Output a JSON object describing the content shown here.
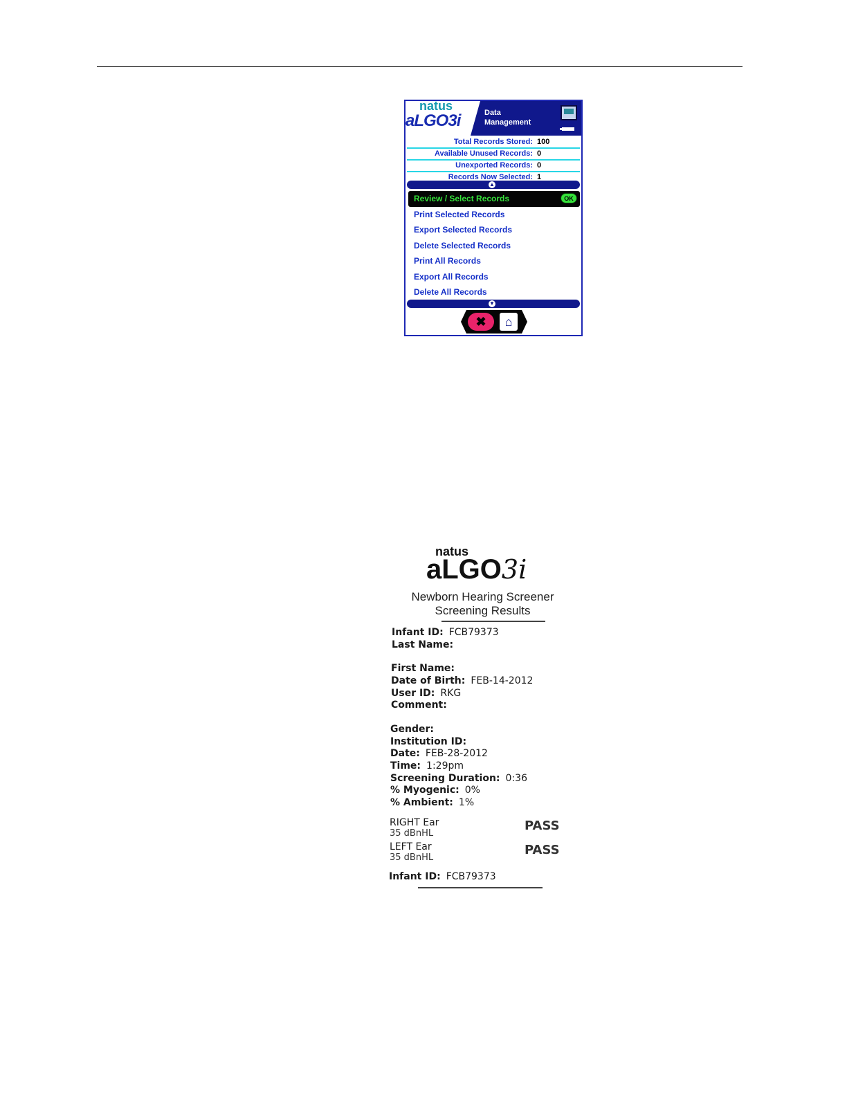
{
  "device_screen": {
    "logo_top": "natus",
    "logo_main": "aLGO",
    "logo_suffix": "3i",
    "title_line1": "Data",
    "title_line2": "Management",
    "stats": [
      {
        "label": "Total Records Stored:",
        "value": "100"
      },
      {
        "label": "Available Unused Records:",
        "value": "0"
      },
      {
        "label": "Unexported Records:",
        "value": "0"
      },
      {
        "label": "Records Now Selected:",
        "value": "1"
      }
    ],
    "scroll_up_icon": "chevron-up-icon",
    "scroll_down_icon": "chevron-down-icon",
    "menu": [
      {
        "label": "Review / Select Records",
        "selected": true,
        "badge": "OK"
      },
      {
        "label": "Print Selected Records"
      },
      {
        "label": "Export Selected Records"
      },
      {
        "label": "Delete Selected Records"
      },
      {
        "label": "Print All Records"
      },
      {
        "label": "Export All Records"
      },
      {
        "label": "Delete All Records"
      }
    ],
    "buttons": {
      "cancel_icon": "close-icon",
      "home_icon": "home-icon",
      "cancel_glyph": "✖",
      "home_glyph": "⌂"
    },
    "colors": {
      "navy": "#10188c",
      "menu_text": "#1530c8",
      "selected_text": "#35e23a",
      "cancel": "#e8236a",
      "divider": "#28d6e6"
    }
  },
  "printout": {
    "logo_top": "natus",
    "logo_main": "aLGO",
    "logo_suffix": "3i",
    "title1": "Newborn Hearing Screener",
    "title2": "Screening Results",
    "fields": {
      "infant_id": {
        "label": "Infant ID:",
        "value": "FCB79373"
      },
      "last_name": {
        "label": "Last Name:",
        "value": ""
      },
      "first_name": {
        "label": "First Name:",
        "value": ""
      },
      "dob": {
        "label": "Date of Birth:",
        "value": "FEB-14-2012"
      },
      "user_id": {
        "label": "User ID:",
        "value": "RKG"
      },
      "comment": {
        "label": "Comment:",
        "value": ""
      },
      "gender": {
        "label": "Gender:",
        "value": ""
      },
      "institution_id": {
        "label": "Institution ID:",
        "value": ""
      },
      "date": {
        "label": "Date:",
        "value": "FEB-28-2012"
      },
      "time": {
        "label": "Time:",
        "value": "1:29pm"
      },
      "duration": {
        "label": "Screening Duration:",
        "value": "0:36"
      },
      "myogenic": {
        "label": "% Myogenic:",
        "value": "0%"
      },
      "ambient": {
        "label": "% Ambient:",
        "value": "1%"
      }
    },
    "right_ear": {
      "label": "RIGHT Ear",
      "level": "35 dBnHL",
      "result": "PASS"
    },
    "left_ear": {
      "label": "LEFT Ear",
      "level": "35 dBnHL",
      "result": "PASS"
    },
    "footer_id": {
      "label": "Infant ID:",
      "value": "FCB79373"
    }
  }
}
